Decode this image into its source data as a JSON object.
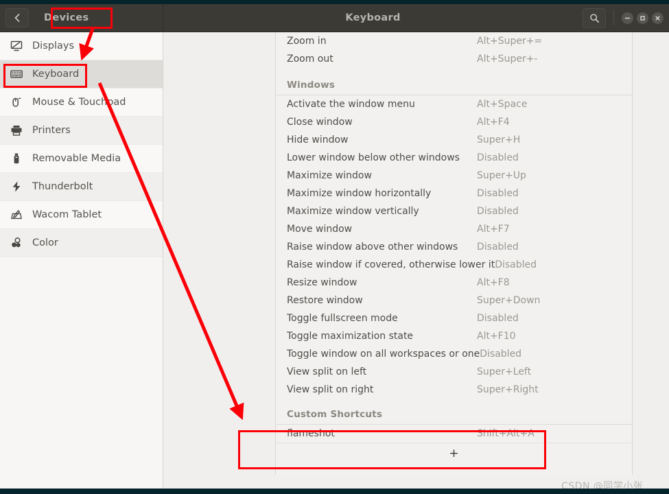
{
  "window": {
    "title": "Keyboard",
    "back_icon": "chevron-left-icon",
    "panel_label": "Devices",
    "search_icon": "search-icon",
    "minimize_icon": "minimize-icon",
    "maximize_icon": "maximize-icon",
    "close_icon": "close-icon"
  },
  "sidebar": {
    "items": [
      {
        "label": "Displays",
        "icon": "display-icon",
        "selected": false
      },
      {
        "label": "Keyboard",
        "icon": "keyboard-icon",
        "selected": true
      },
      {
        "label": "Mouse & Touchpad",
        "icon": "mouse-icon",
        "selected": false
      },
      {
        "label": "Printers",
        "icon": "printer-icon",
        "selected": false
      },
      {
        "label": "Removable Media",
        "icon": "usb-drive-icon",
        "selected": false
      },
      {
        "label": "Thunderbolt",
        "icon": "thunderbolt-icon",
        "selected": false
      },
      {
        "label": "Wacom Tablet",
        "icon": "wacom-tablet-icon",
        "selected": false
      },
      {
        "label": "Color",
        "icon": "color-profile-icon",
        "selected": false
      }
    ]
  },
  "shortcuts": {
    "top_rows": [
      {
        "name": "Zoom in",
        "accel": "Alt+Super+="
      },
      {
        "name": "Zoom out",
        "accel": "Alt+Super+-"
      }
    ],
    "group_windows": {
      "header": "Windows",
      "rows": [
        {
          "name": "Activate the window menu",
          "accel": "Alt+Space"
        },
        {
          "name": "Close window",
          "accel": "Alt+F4"
        },
        {
          "name": "Hide window",
          "accel": "Super+H"
        },
        {
          "name": "Lower window below other windows",
          "accel": "Disabled"
        },
        {
          "name": "Maximize window",
          "accel": "Super+Up"
        },
        {
          "name": "Maximize window horizontally",
          "accel": "Disabled"
        },
        {
          "name": "Maximize window vertically",
          "accel": "Disabled"
        },
        {
          "name": "Move window",
          "accel": "Alt+F7"
        },
        {
          "name": "Raise window above other windows",
          "accel": "Disabled"
        },
        {
          "name": "Raise window if covered, otherwise lower it",
          "accel": "Disabled"
        },
        {
          "name": "Resize window",
          "accel": "Alt+F8"
        },
        {
          "name": "Restore window",
          "accel": "Super+Down"
        },
        {
          "name": "Toggle fullscreen mode",
          "accel": "Disabled"
        },
        {
          "name": "Toggle maximization state",
          "accel": "Alt+F10"
        },
        {
          "name": "Toggle window on all workspaces or one",
          "accel": "Disabled"
        },
        {
          "name": "View split on left",
          "accel": "Super+Left"
        },
        {
          "name": "View split on right",
          "accel": "Super+Right"
        }
      ]
    },
    "group_custom": {
      "header": "Custom Shortcuts",
      "rows": [
        {
          "name": "flameshot",
          "accel": "Shift+Alt+A"
        }
      ],
      "add_label": "+"
    }
  },
  "watermark": {
    "text": "CSDN @同学小张"
  },
  "annotations": {
    "highlight_color": "#fb0007",
    "boxes": [
      "devices-panel-label",
      "sidebar-item-keyboard",
      "custom-shortcuts-list"
    ],
    "arrows": [
      "devices-to-displays-arrow",
      "keyboard-to-custom-shortcuts-arrow"
    ]
  }
}
